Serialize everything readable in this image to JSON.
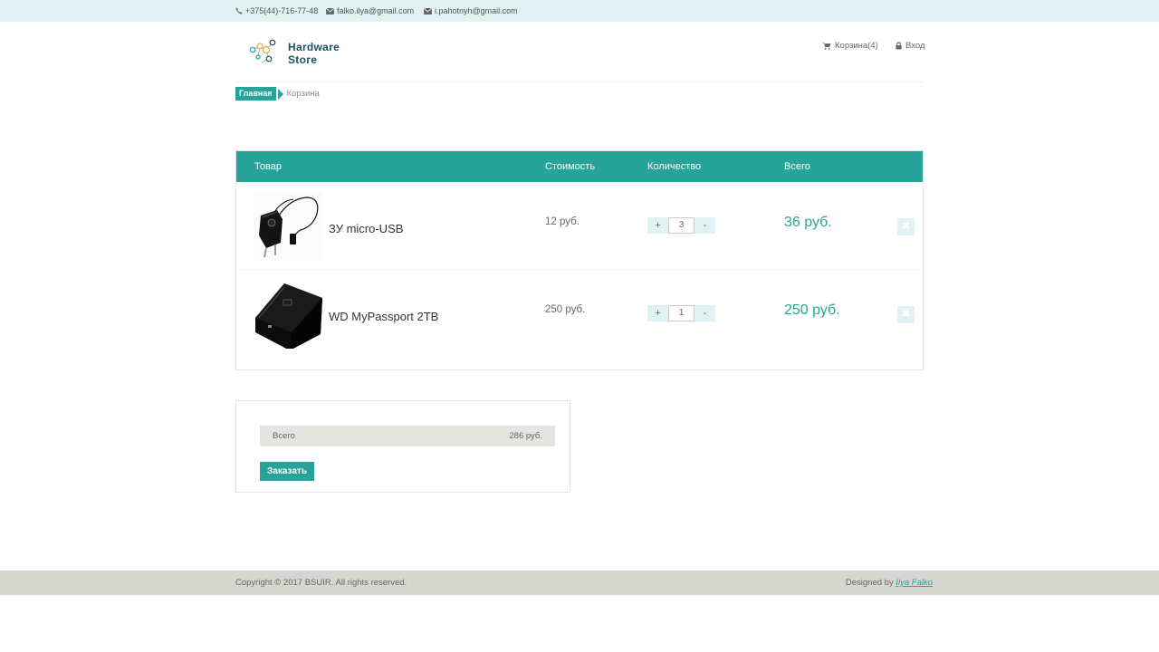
{
  "topbar": {
    "phone": "+375(44)-716-77-48",
    "email_1": "falko.ilya@gmail.com",
    "email_2": "i.pahotnyh@gmail.com"
  },
  "header": {
    "logo_line1": "Hardware",
    "logo_line2": "Store",
    "cart_label": "Корзина(4)",
    "login_label": "Вход"
  },
  "breadcrumb": {
    "home": "Главная",
    "current": "Корзина"
  },
  "cart": {
    "columns": {
      "product": "Товар",
      "price": "Стоимость",
      "quantity": "Количество",
      "total": "Всего"
    },
    "items": [
      {
        "name": "ЗУ micro-USB",
        "price": "12 руб.",
        "quantity": "3",
        "total": "36 руб.",
        "plus": "+",
        "minus": "-",
        "delete": "✖"
      },
      {
        "name": "WD MyPassport 2TB",
        "price": "250 руб.",
        "quantity": "1",
        "total": "250 руб.",
        "plus": "+",
        "minus": "-",
        "delete": "✖"
      }
    ]
  },
  "summary": {
    "label": "Всего",
    "value": "286 руб.",
    "order_button": "Заказать"
  },
  "footer": {
    "copyright": "Copyright © 2017 BSUIR. All rights reserved.",
    "designed_by": "Designed by",
    "designer": "Ilya Falko"
  },
  "colors": {
    "accent": "#26a49a",
    "topbar_bg": "#e2f1f1",
    "footer_bg": "#d6d6d0",
    "summary_row_bg": "#e6e4df"
  },
  "icons": [
    "phone-icon",
    "envelope-icon",
    "cart-icon",
    "lock-icon",
    "close-icon"
  ]
}
